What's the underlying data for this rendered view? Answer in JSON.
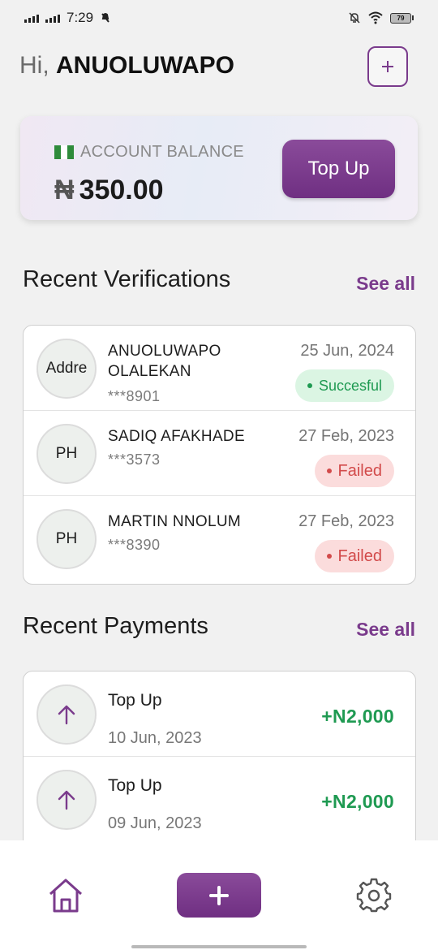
{
  "status_bar": {
    "time": "7:29",
    "battery": "79"
  },
  "header": {
    "greeting": "Hi,",
    "name": "ANUOLUWAPO",
    "add_icon": "plus-icon"
  },
  "balance_card": {
    "label": "ACCOUNT BALANCE",
    "currency_symbol": "₦",
    "amount": "350.00",
    "top_up_label": "Top Up"
  },
  "verifications": {
    "title": "Recent Verifications",
    "see_all": "See all",
    "items": [
      {
        "avatar": "Addre",
        "name_line1": "ANUOLUWAPO",
        "name_line2": "OLALEKAN",
        "id": "***8901",
        "date": "25 Jun, 2024",
        "status": "Succesful"
      },
      {
        "avatar": "PH",
        "name_line1": "SADIQ AFAKHADE",
        "name_line2": "",
        "id": "***3573",
        "date": "27 Feb, 2023",
        "status": "Failed"
      },
      {
        "avatar": "PH",
        "name_line1": "MARTIN NNOLUM",
        "name_line2": "",
        "id": "***8390",
        "date": "27 Feb, 2023",
        "status": "Failed"
      }
    ]
  },
  "payments": {
    "title": "Recent Payments",
    "see_all": "See all",
    "items": [
      {
        "title": "Top Up",
        "date": "10 Jun, 2023",
        "amount": "+N2,000",
        "icon": "arrow-up-icon"
      },
      {
        "title": "Top Up",
        "date": "09 Jun, 2023",
        "amount": "+N2,000",
        "icon": "arrow-up-icon"
      }
    ]
  },
  "bottom_nav": {
    "home_icon": "home-icon",
    "add_icon": "plus-icon",
    "settings_icon": "gear-icon"
  },
  "colors": {
    "accent": "#7a3b8c",
    "success": "#1f9a52",
    "failed": "#d24a4a"
  }
}
